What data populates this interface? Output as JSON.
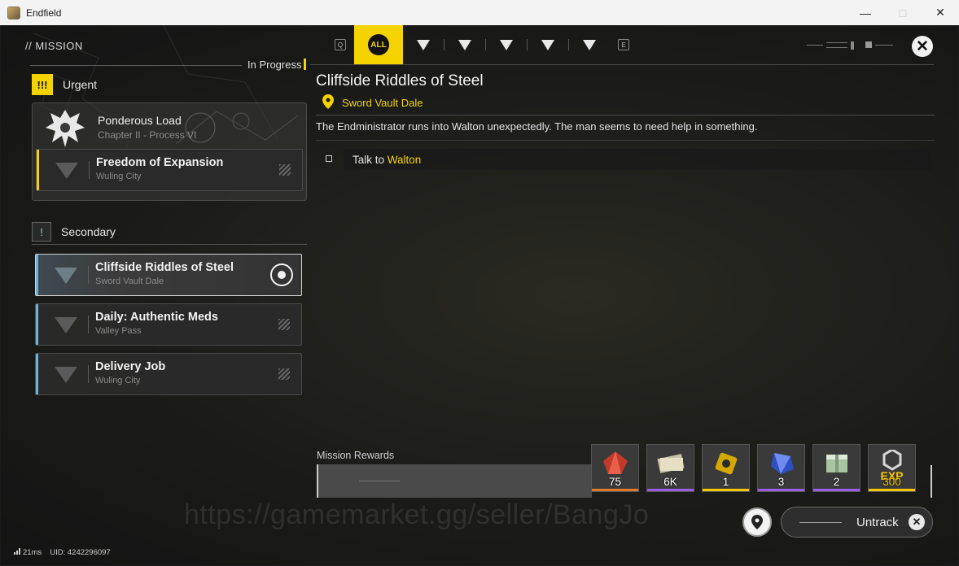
{
  "window": {
    "title": "Endfield"
  },
  "header": {
    "section": "// MISSION",
    "in_progress": "In Progress"
  },
  "tabs": {
    "left_key": "Q",
    "right_key": "E",
    "active_label": "ALL",
    "items": [
      "all",
      "main",
      "side",
      "event",
      "daily",
      "misc"
    ]
  },
  "urgent": {
    "label": "Urgent",
    "badge": "!!!",
    "chapter_title": "Ponderous Load",
    "chapter_sub": "Chapter II - Process VI",
    "quest": {
      "title": "Freedom of Expansion",
      "location": "Wuling City"
    }
  },
  "secondary": {
    "label": "Secondary",
    "badge": "!",
    "quests": [
      {
        "title": "Cliffside Riddles of Steel",
        "location": "Sword Vault Dale",
        "selected": true
      },
      {
        "title": "Daily: Authentic Meds",
        "location": "Valley Pass",
        "selected": false
      },
      {
        "title": "Delivery Job",
        "location": "Wuling City",
        "selected": false
      }
    ]
  },
  "detail": {
    "title": "Cliffside Riddles of Steel",
    "location": "Sword Vault Dale",
    "description": "The Endministrator runs into Walton unexpectedly. The man seems to need help in something.",
    "objective_prefix": "Talk to ",
    "objective_target": "Walton"
  },
  "rewards": {
    "label": "Mission Rewards",
    "items": [
      {
        "name": "red-crystal",
        "count": "75",
        "rarity_color": "#e07a2a"
      },
      {
        "name": "credit-bills",
        "count": "6K",
        "rarity_color": "#9b5de5"
      },
      {
        "name": "gold-component",
        "count": "1",
        "rarity_color": "#f5c800"
      },
      {
        "name": "blue-crystal",
        "count": "3",
        "rarity_color": "#9b5de5"
      },
      {
        "name": "green-crate",
        "count": "2",
        "rarity_color": "#9b5de5"
      },
      {
        "name": "exp",
        "count": "300",
        "label": "EXP",
        "rarity_color": "#f5c800"
      }
    ]
  },
  "controls": {
    "untrack_label": "Untrack"
  },
  "watermark": "https://gamemarket.gg/seller/BangJo",
  "status": {
    "ping": "21ms",
    "uid": "UID: 4242296097"
  },
  "colors": {
    "accent": "#f5d300",
    "secondary_accent": "#6fb3d9"
  }
}
